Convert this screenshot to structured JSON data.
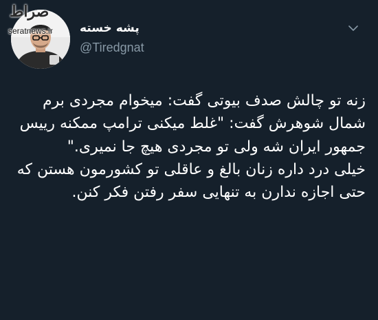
{
  "watermark": {
    "logo": "صراط",
    "url": "seratnews.ir"
  },
  "author": {
    "display_name": "پشه خسته",
    "handle": "@Tiredgnat"
  },
  "tweet": {
    "text": "زنه تو چالش صدف بیوتی گفت: میخوام مجردی برم شمال شوهرش گفت: \"غلط میکنی ترامپ ممکنه رییس جمهور ایران شه ولی تو مجردی هیچ جا نمیری.\"\nخیلی درد داره زنان بالغ و عاقلی تو کشورمون هستن که حتی اجازه ندارن به تنهایی سفر رفتن فکر کنن."
  },
  "icons": {
    "menu": "chevron-down-icon"
  },
  "colors": {
    "background": "#15202b",
    "text": "#ffffff",
    "secondary_text": "#8899a6"
  }
}
